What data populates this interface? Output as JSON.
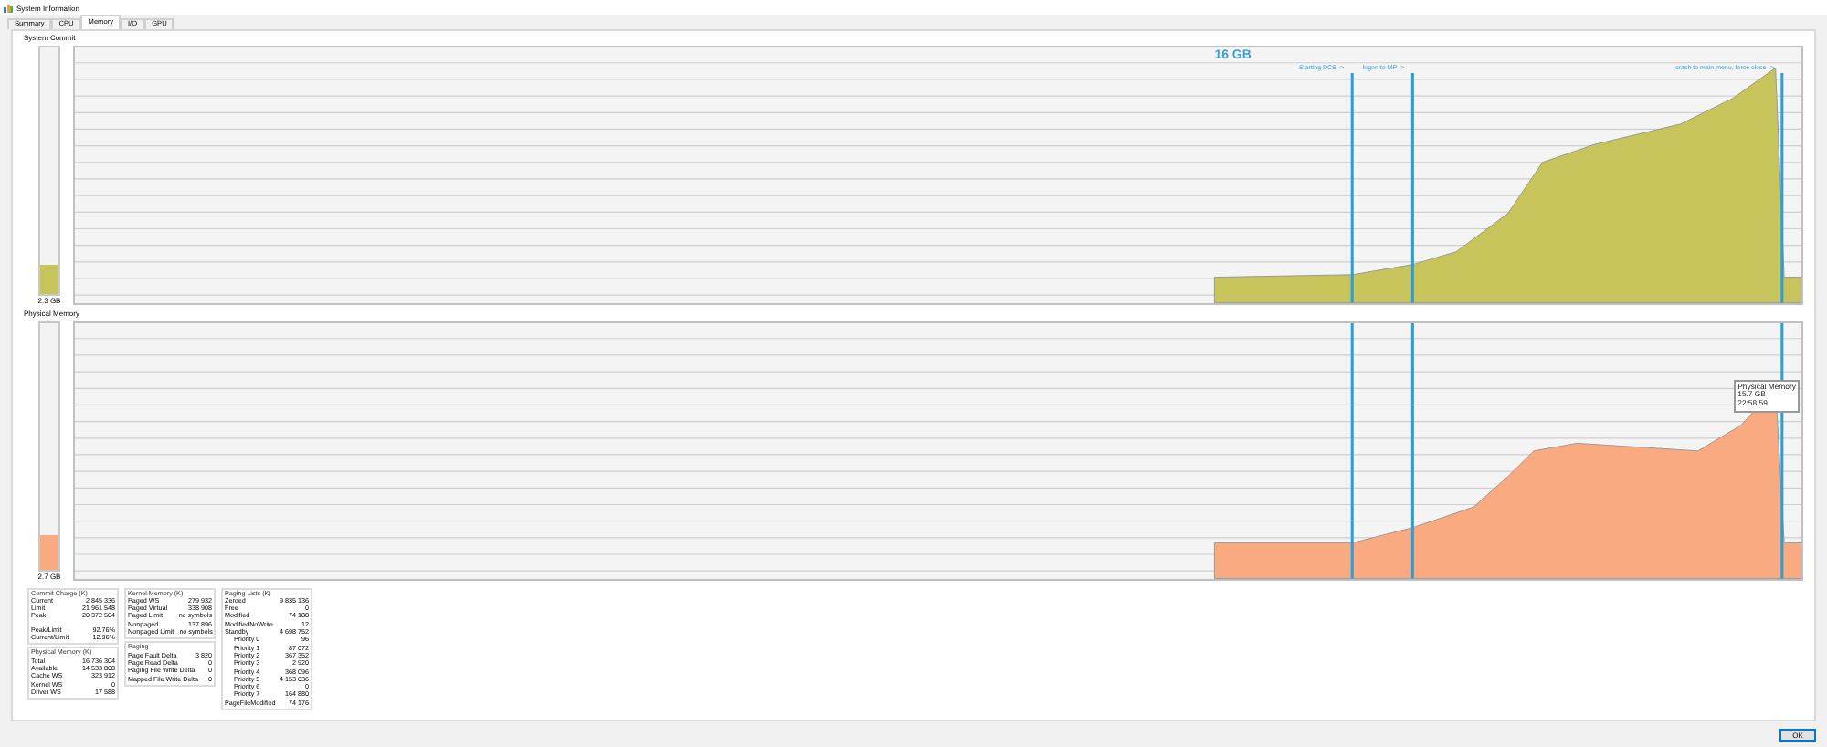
{
  "window": {
    "title": "System Information"
  },
  "tabs": [
    {
      "label": "Summary",
      "selected": false
    },
    {
      "label": "CPU",
      "selected": false
    },
    {
      "label": "Memory",
      "selected": true
    },
    {
      "label": "I/O",
      "selected": false
    },
    {
      "label": "GPU",
      "selected": false
    }
  ],
  "graphs": [
    {
      "title": "System Commit",
      "meter_label": "2.3 GB",
      "level": 0.12,
      "color": "#c8c45c",
      "annotations": [
        "16 GB",
        "Starting DCS ->",
        "logon to MP ->",
        "crash to main menu, force close ->"
      ]
    },
    {
      "title": "Physical Memory",
      "meter_label": "2.7 GB",
      "level": 0.14,
      "color": "#f9aa80",
      "tooltip": [
        "Physical Memory",
        "15.7 GB",
        "22:58:59"
      ]
    }
  ],
  "info_columns": [
    [
      {
        "title": "Commit Charge (K)",
        "rows": [
          {
            "label": "Current",
            "value": "2 845 336"
          },
          {
            "label": "Limit",
            "value": "21 961 548"
          },
          {
            "label": "Peak",
            "value": "20 372 504"
          },
          {
            "label": "Peak/Limit",
            "value": "92.76%"
          },
          {
            "label": "Current/Limit",
            "value": "12.96%"
          }
        ]
      },
      {
        "title": "Physical Memory (K)",
        "rows": [
          {
            "label": "Total",
            "value": "16 736 304"
          },
          {
            "label": "Available",
            "value": "14 533 808"
          },
          {
            "label": "Cache WS",
            "value": "323 912"
          },
          {
            "label": "Kernel WS",
            "value": "0"
          },
          {
            "label": "Driver WS",
            "value": "17 588"
          }
        ]
      }
    ],
    [
      {
        "title": "Kernel Memory (K)",
        "rows": [
          {
            "label": "Paged WS",
            "value": "279 932"
          },
          {
            "label": "Paged Virtual",
            "value": "338 908"
          },
          {
            "label": "Paged Limit",
            "value": "no symbols"
          },
          {
            "label": "Nonpaged",
            "value": "137 896"
          },
          {
            "label": "Nonpaged Limit",
            "value": "no symbols"
          }
        ]
      },
      {
        "title": "Paging",
        "rows": [
          {
            "label": "Page Fault Delta",
            "value": "3 820"
          },
          {
            "label": "Page Read Delta",
            "value": "0"
          },
          {
            "label": "Paging File Write Delta",
            "value": "0"
          },
          {
            "label": "Mapped File Write Delta",
            "value": "0"
          }
        ]
      }
    ],
    [
      {
        "title": "Paging Lists (K)",
        "rows": [
          {
            "label": "Zeroed",
            "value": "9 835 136"
          },
          {
            "label": "Free",
            "value": "0"
          },
          {
            "label": "Modified",
            "value": "74 188"
          },
          {
            "label": "ModifiedNoWrite",
            "value": "12"
          },
          {
            "label": "Standby",
            "value": "4 698 752",
            "children": [
              {
                "label": "Priority 0",
                "value": "96"
              },
              {
                "label": "Priority 1",
                "value": "87 072"
              },
              {
                "label": "Priority 2",
                "value": "367 352"
              },
              {
                "label": "Priority 3",
                "value": "2 920"
              },
              {
                "label": "Priority 4",
                "value": "368 096"
              },
              {
                "label": "Priority 5",
                "value": "4 153 036"
              },
              {
                "label": "Priority 6",
                "value": "0"
              },
              {
                "label": "Priority 7",
                "value": "164 880"
              }
            ]
          },
          {
            "label": "PageFileModified",
            "value": "74 176"
          }
        ]
      }
    ]
  ],
  "buttons": [
    "OK"
  ]
}
